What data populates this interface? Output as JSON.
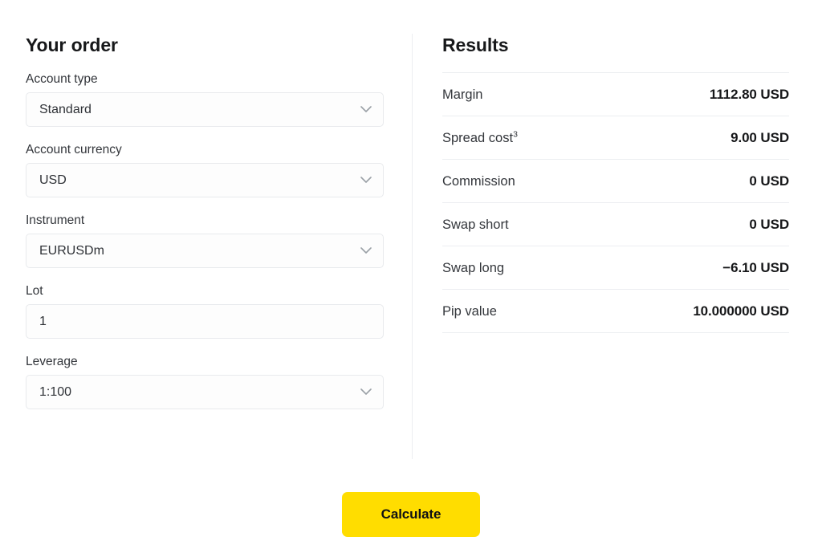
{
  "theme": {
    "background": "#ffffff",
    "accent": "#ffdd00",
    "text_primary": "#17181a",
    "text_secondary": "#33363b",
    "border": "#e8eaed",
    "divider": "#eceef1"
  },
  "order": {
    "title": "Your order",
    "fields": [
      {
        "label": "Account type",
        "value": "Standard",
        "type": "select",
        "icon": "chevron-down-icon",
        "name": "account-type"
      },
      {
        "label": "Account currency",
        "value": "USD",
        "type": "select",
        "icon": "chevron-down-icon",
        "name": "account-currency"
      },
      {
        "label": "Instrument",
        "value": "EURUSDm",
        "type": "select",
        "icon": "chevron-down-icon",
        "name": "instrument"
      },
      {
        "label": "Lot",
        "value": "1",
        "type": "text",
        "icon": "",
        "name": "lot"
      },
      {
        "label": "Leverage",
        "value": "1:100",
        "type": "select",
        "icon": "chevron-down-icon",
        "name": "leverage"
      }
    ]
  },
  "results": {
    "title": "Results",
    "rows": [
      {
        "label": "Margin",
        "superscript": "",
        "value": "1112.80 USD",
        "name": "margin"
      },
      {
        "label": "Spread cost",
        "superscript": "3",
        "value": "9.00 USD",
        "name": "spread-cost"
      },
      {
        "label": "Commission",
        "superscript": "",
        "value": "0 USD",
        "name": "commission"
      },
      {
        "label": "Swap short",
        "superscript": "",
        "value": "0 USD",
        "name": "swap-short"
      },
      {
        "label": "Swap long",
        "superscript": "",
        "value": "−6.10 USD",
        "name": "swap-long"
      },
      {
        "label": "Pip value",
        "superscript": "",
        "value": "10.000000 USD",
        "name": "pip-value"
      }
    ]
  },
  "actions": {
    "calculate_label": "Calculate"
  }
}
